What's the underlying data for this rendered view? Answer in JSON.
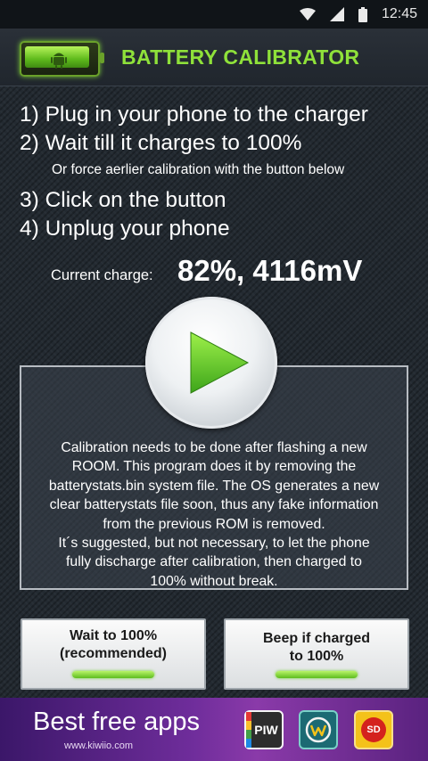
{
  "status_bar": {
    "time": "12:45",
    "icons": [
      "wifi-icon",
      "cell-signal-icon",
      "battery-icon"
    ]
  },
  "app_bar": {
    "title": "BATTERY CALIBRATOR",
    "logo_icon": "android-battery-icon"
  },
  "steps": [
    "1) Plug in your phone to the charger",
    "2) Wait till it charges to 100%",
    "3) Click on the button",
    "4) Unplug your phone"
  ],
  "note": "Or force aerlier calibration with the button below",
  "charge": {
    "label": "Current charge:",
    "value": "82%, 4116mV"
  },
  "play_button_icon": "play-icon",
  "info_lines": [
    "Calibration needs to be done after flashing a new",
    "ROOM. This program does it by removing the",
    "batterystats.bin system file. The OS generates a new",
    "clear batterystats file soon, thus any fake information",
    "from the previous ROM is removed.",
    "It´s suggested, but not necessary, to let the phone",
    "fully discharge after calibration, then charged to",
    "100% without break."
  ],
  "buttons": {
    "wait": {
      "line1": "Wait to 100%",
      "line2": "(recommended)"
    },
    "beep": {
      "line1": "Beep if charged",
      "line2": "to 100%"
    }
  },
  "ad": {
    "title": "Best free apps",
    "url": "www.kiwiio.com",
    "apps": [
      {
        "label": "PIW",
        "icon": "piw-app-icon"
      },
      {
        "label": "",
        "icon": "w-app-icon"
      },
      {
        "label": "SD",
        "icon": "sd-app-icon"
      }
    ]
  },
  "colors": {
    "accent_green": "#8fe13a",
    "background": "#232a31",
    "ad_purple": "#6f2d9b"
  }
}
